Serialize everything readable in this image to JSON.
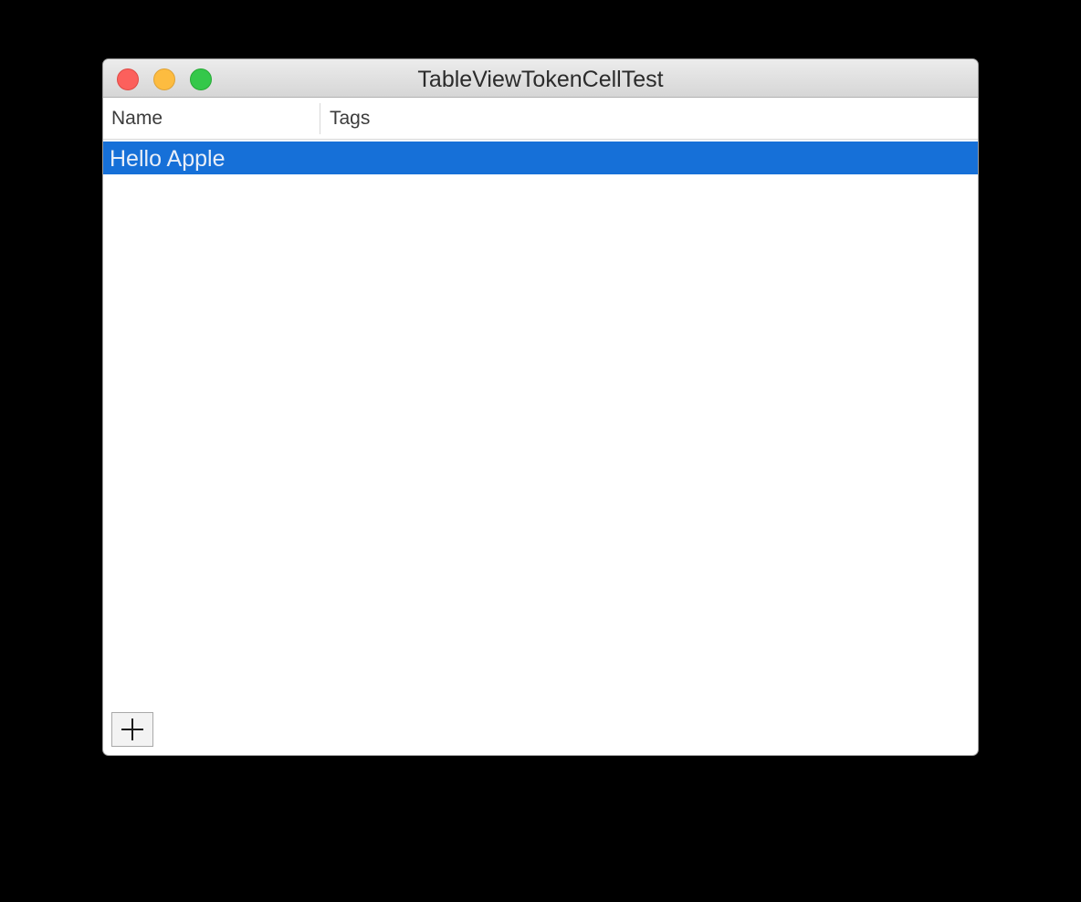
{
  "window": {
    "title": "TableViewTokenCellTest"
  },
  "table": {
    "columns": [
      {
        "label": "Name"
      },
      {
        "label": "Tags"
      }
    ],
    "rows": [
      {
        "name": "Hello Apple",
        "tags": "",
        "selected": true
      }
    ]
  },
  "footer": {
    "add_icon": "plus-icon"
  },
  "colors": {
    "selection": "#1670d8",
    "close": "#fc605c",
    "minimize": "#fdbc40",
    "zoom": "#34c84a"
  }
}
